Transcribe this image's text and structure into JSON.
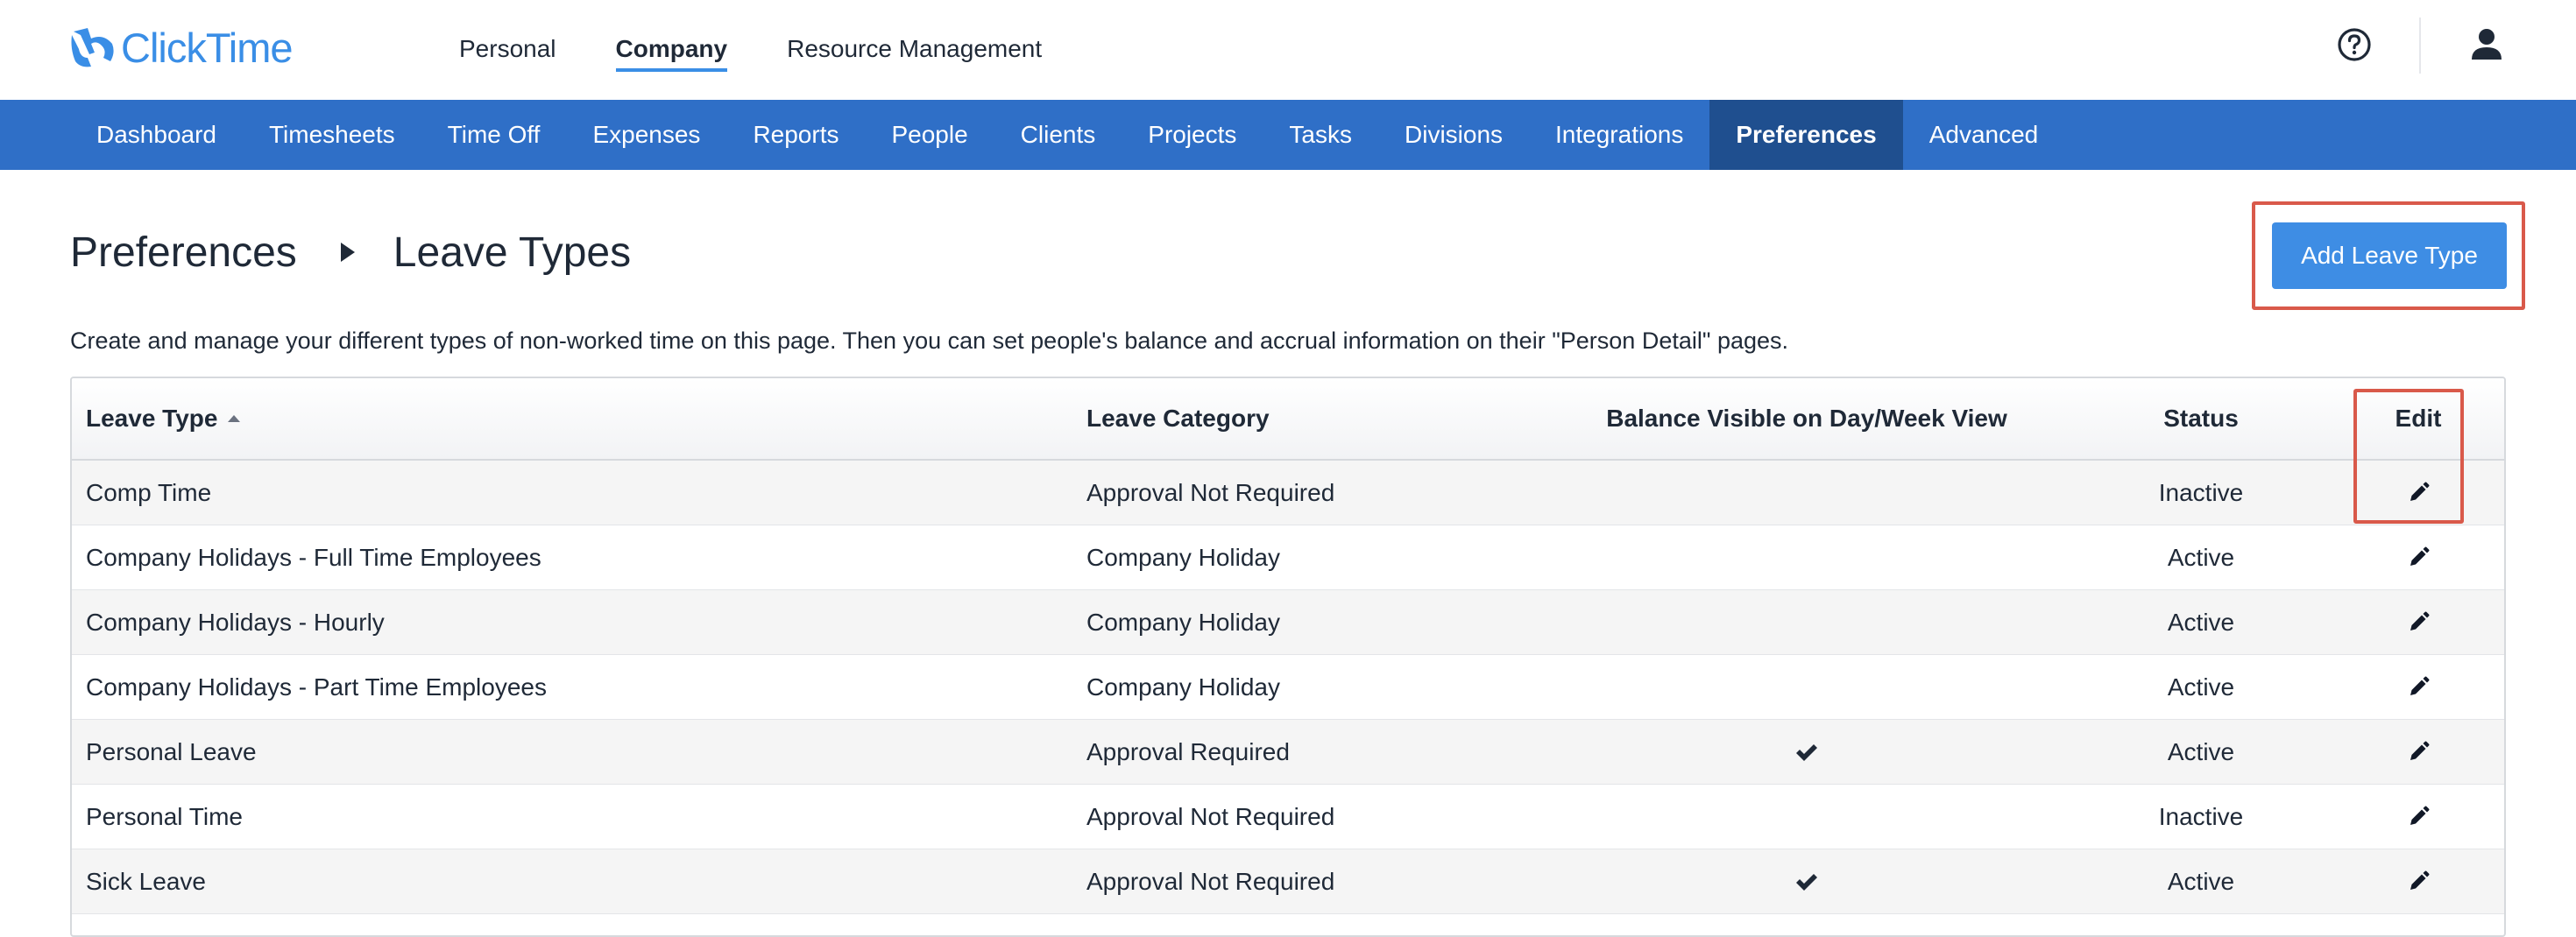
{
  "app": {
    "logo_text": "ClickTime",
    "brand_color": "#3a8ee6"
  },
  "topnav": {
    "items": [
      {
        "label": "Personal",
        "active": false
      },
      {
        "label": "Company",
        "active": true
      },
      {
        "label": "Resource Management",
        "active": false
      }
    ],
    "icons": [
      "help-circle-icon",
      "user-icon"
    ]
  },
  "mainnav": {
    "bar_color": "#2f6fc7",
    "items": [
      {
        "label": "Dashboard"
      },
      {
        "label": "Timesheets"
      },
      {
        "label": "Time Off"
      },
      {
        "label": "Expenses"
      },
      {
        "label": "Reports"
      },
      {
        "label": "People"
      },
      {
        "label": "Clients"
      },
      {
        "label": "Projects"
      },
      {
        "label": "Tasks"
      },
      {
        "label": "Divisions"
      },
      {
        "label": "Integrations"
      },
      {
        "label": "Preferences",
        "active": true
      },
      {
        "label": "Advanced"
      }
    ]
  },
  "page": {
    "breadcrumb": [
      "Preferences",
      "Leave Types"
    ],
    "add_button_label": "Add Leave Type",
    "description": "Create and manage your different types of non-worked time on this page. Then you can set people's balance and accrual information on their \"Person Detail\" pages."
  },
  "table": {
    "columns": [
      "Leave Type",
      "Leave Category",
      "Balance Visible on Day/Week View",
      "Status",
      "Edit"
    ],
    "sorted_column": "Leave Type",
    "rows": [
      {
        "type": "Comp Time",
        "category": "Approval Not Required",
        "balance_visible": false,
        "status": "Inactive"
      },
      {
        "type": "Company Holidays - Full Time Employees",
        "category": "Company Holiday",
        "balance_visible": false,
        "status": "Active"
      },
      {
        "type": "Company Holidays - Hourly",
        "category": "Company Holiday",
        "balance_visible": false,
        "status": "Active"
      },
      {
        "type": "Company Holidays - Part Time Employees",
        "category": "Company Holiday",
        "balance_visible": false,
        "status": "Active"
      },
      {
        "type": "Personal Leave",
        "category": "Approval Required",
        "balance_visible": true,
        "status": "Active"
      },
      {
        "type": "Personal Time",
        "category": "Approval Not Required",
        "balance_visible": false,
        "status": "Inactive"
      },
      {
        "type": "Sick Leave",
        "category": "Approval Not Required",
        "balance_visible": true,
        "status": "Active"
      }
    ]
  },
  "highlights": {
    "color": "#d9594a",
    "targets": [
      "add-leave-type-button",
      "edit-column"
    ]
  }
}
